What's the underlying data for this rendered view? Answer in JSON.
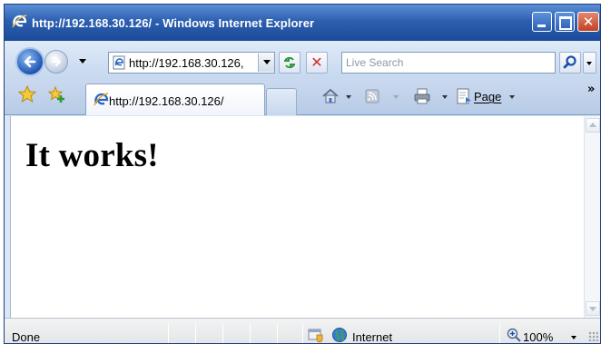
{
  "window": {
    "title": "http://192.168.30.126/ - Windows Internet Explorer"
  },
  "address_bar": {
    "url": "http://192.168.30.126/",
    "url_visible": "http://192.168.30.126,"
  },
  "search": {
    "placeholder": "Live Search"
  },
  "tabs": [
    {
      "label": "http://192.168.30.126/",
      "active": true
    }
  ],
  "command_bar": {
    "page_label": "Page",
    "more": "»"
  },
  "page": {
    "heading": "It works!"
  },
  "status_bar": {
    "status": "Done",
    "zone": "Internet",
    "zoom": "100%"
  },
  "colors": {
    "title_bar": "#2d5fb0",
    "close_button": "#c24224",
    "stop_x": "#d2322a",
    "content_background": "#ffffff"
  },
  "icons": [
    "ie-logo-icon",
    "minimize-icon",
    "maximize-icon",
    "close-icon",
    "back-arrow-icon",
    "forward-arrow-icon",
    "page-icon",
    "refresh-icon",
    "stop-icon",
    "search-icon",
    "favorites-star-icon",
    "add-favorites-icon",
    "home-icon",
    "feeds-icon",
    "print-icon",
    "page-menu-icon",
    "security-zone-icon",
    "globe-icon",
    "zoom-icon",
    "resize-grip-icon"
  ]
}
